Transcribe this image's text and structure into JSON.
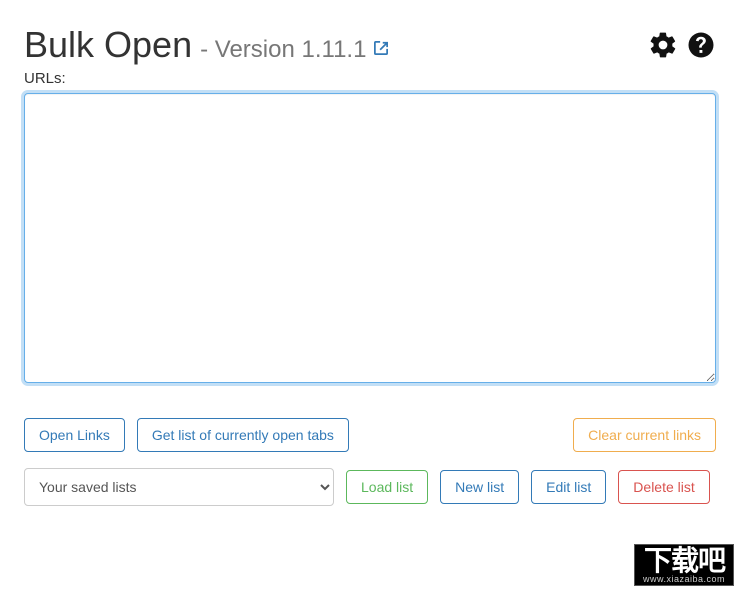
{
  "header": {
    "title": "Bulk Open",
    "version_prefix": "- Version ",
    "version": "1.11.1"
  },
  "labels": {
    "urls": "URLs:"
  },
  "textarea": {
    "value": "",
    "placeholder": ""
  },
  "buttons": {
    "open_links": "Open Links",
    "get_open_tabs": "Get list of currently open tabs",
    "clear_links": "Clear current links",
    "load_list": "Load list",
    "new_list": "New list",
    "edit_list": "Edit list",
    "delete_list": "Delete list"
  },
  "select": {
    "placeholder": "Your saved lists"
  },
  "watermark": {
    "big": "下载吧",
    "small": "www.xiazaiba.com"
  }
}
